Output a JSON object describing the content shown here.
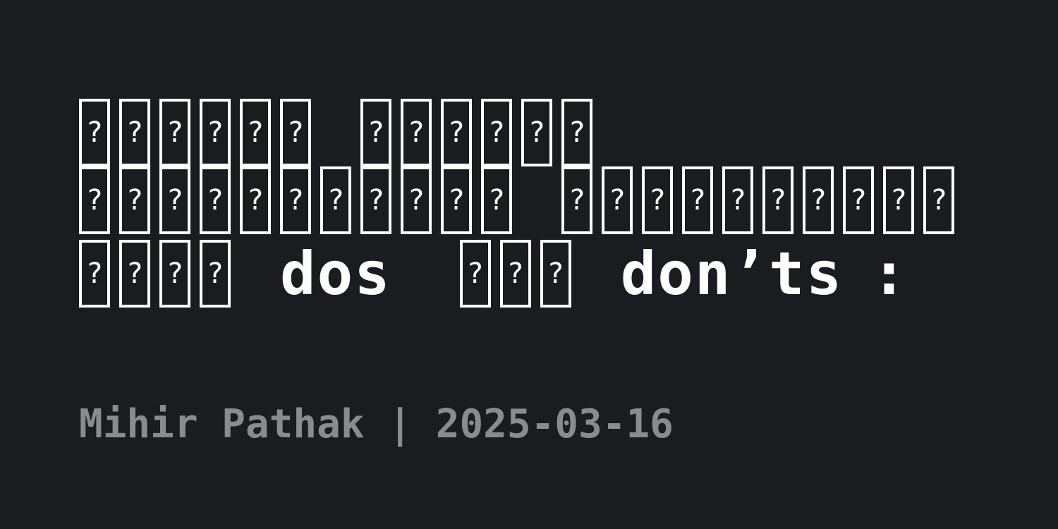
{
  "title": {
    "line1_glyph_groups": [
      6,
      6
    ],
    "line2_glyph_groups": [
      11,
      10
    ],
    "line3": [
      {
        "glyphs": 4
      },
      {
        "word": "dos"
      },
      {
        "glyphs": 3
      },
      {
        "word": "don’ts"
      },
      {
        "word": ":"
      }
    ],
    "missing_glyph": "?"
  },
  "meta": {
    "author": "Mihir Pathak",
    "separator": "|",
    "date": "2025-03-16"
  }
}
